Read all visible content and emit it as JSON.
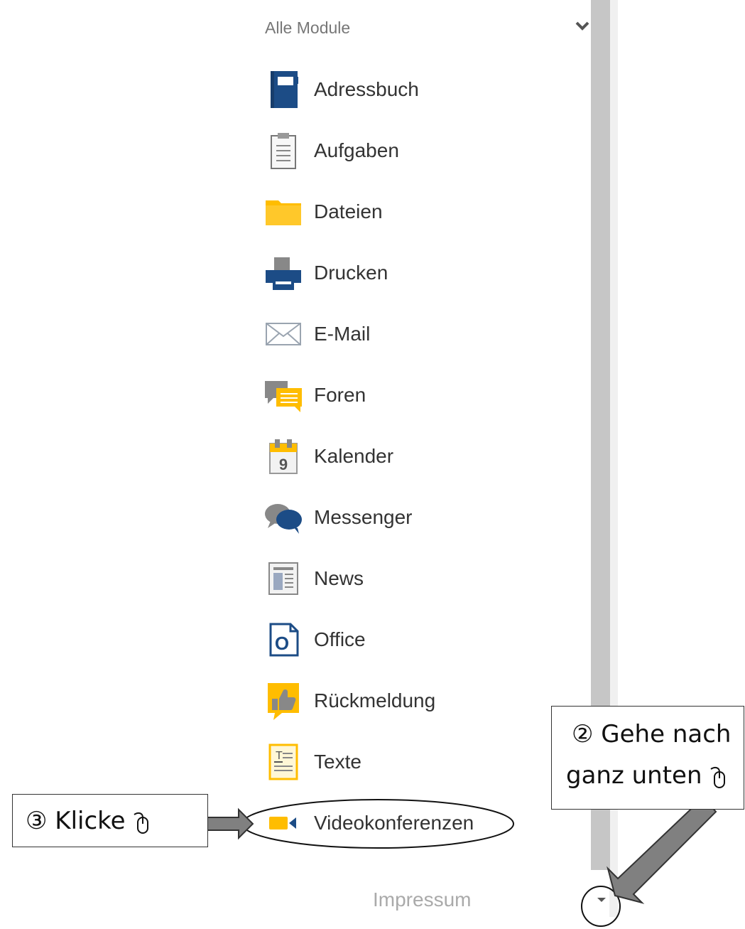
{
  "section": {
    "title": "Alle Module"
  },
  "modules": [
    {
      "label": "Adressbuch",
      "icon": "address-book-icon"
    },
    {
      "label": "Aufgaben",
      "icon": "task-clipboard-icon"
    },
    {
      "label": "Dateien",
      "icon": "folder-icon"
    },
    {
      "label": "Drucken",
      "icon": "printer-icon"
    },
    {
      "label": "E-Mail",
      "icon": "envelope-icon"
    },
    {
      "label": "Foren",
      "icon": "forum-icon"
    },
    {
      "label": "Kalender",
      "icon": "calendar-icon",
      "icon_text": "9"
    },
    {
      "label": "Messenger",
      "icon": "chat-bubbles-icon"
    },
    {
      "label": "News",
      "icon": "newspaper-icon"
    },
    {
      "label": "Office",
      "icon": "office-icon",
      "icon_text": "O"
    },
    {
      "label": "Rückmeldung",
      "icon": "thumbs-up-icon"
    },
    {
      "label": "Texte",
      "icon": "text-document-icon",
      "icon_text": "T"
    },
    {
      "label": "Videokonferenzen",
      "icon": "video-camera-icon"
    }
  ],
  "footer": {
    "impressum": "Impressum"
  },
  "annotations": {
    "step2": {
      "number": "②",
      "line1": "Gehe nach",
      "line2": "ganz unten"
    },
    "step3": {
      "number": "③",
      "text": "Klicke"
    }
  },
  "colors": {
    "brand_blue": "#1c4c86",
    "brand_yellow": "#ffbd00",
    "scrollbar": "#c6c6c6",
    "arrow_gray": "#808080"
  }
}
